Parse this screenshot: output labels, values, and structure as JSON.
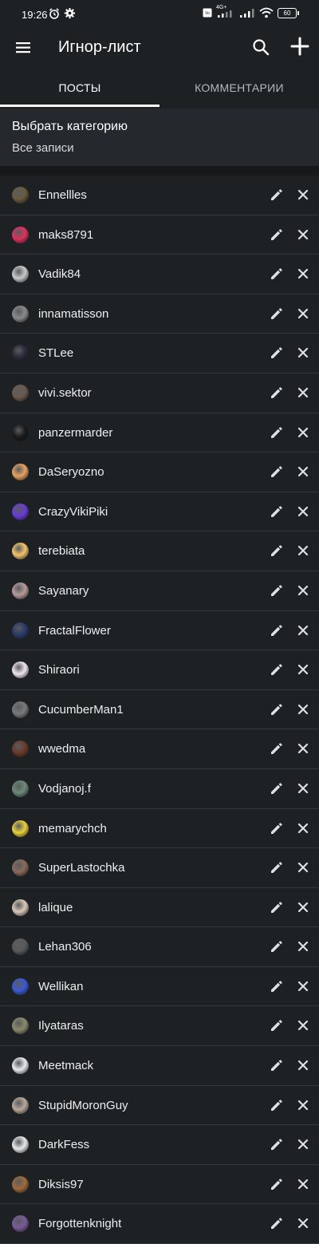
{
  "status_bar": {
    "time": "19:26",
    "network": "4G+",
    "battery": "60"
  },
  "toolbar": {
    "title": "Игнор-лист"
  },
  "tabs": [
    {
      "label": "ПОСТЫ",
      "active": true
    },
    {
      "label": "КОММЕНТАРИИ",
      "active": false
    }
  ],
  "category": {
    "label": "Выбрать категорию",
    "value": "Все записи"
  },
  "users": [
    {
      "name": "Ennellles",
      "avatar_color": "#6b5a3e"
    },
    {
      "name": "maks8791",
      "avatar_color": "#e0305a"
    },
    {
      "name": "Vadik84",
      "avatar_color": "#c8c8c8"
    },
    {
      "name": "innamatisson",
      "avatar_color": "#8a8a8a"
    },
    {
      "name": "STLee",
      "avatar_color": "#2a2a3a"
    },
    {
      "name": "vivi.sektor",
      "avatar_color": "#6e5a4e"
    },
    {
      "name": "panzermarder",
      "avatar_color": "#1a1a1a"
    },
    {
      "name": "DaSeryozno",
      "avatar_color": "#e8a060"
    },
    {
      "name": "CrazyVikiPiki",
      "avatar_color": "#6a3bd6"
    },
    {
      "name": "terebiata",
      "avatar_color": "#f2c46a"
    },
    {
      "name": "Sayanary",
      "avatar_color": "#b89a9a"
    },
    {
      "name": "FractalFlower",
      "avatar_color": "#2a3a6a"
    },
    {
      "name": "Shiraori",
      "avatar_color": "#f0e6ee"
    },
    {
      "name": "CucumberMan1",
      "avatar_color": "#7a7a7a"
    },
    {
      "name": "wwedma",
      "avatar_color": "#6a3a2a"
    },
    {
      "name": "Vodjanoj.f",
      "avatar_color": "#6a8a7a"
    },
    {
      "name": "memarychch",
      "avatar_color": "#e8d03a"
    },
    {
      "name": "SuperLastochka",
      "avatar_color": "#8a6a5a"
    },
    {
      "name": "lalique",
      "avatar_color": "#d8c8b8"
    },
    {
      "name": "Lehan306",
      "avatar_color": "#5a5a5a"
    },
    {
      "name": "Wellikan",
      "avatar_color": "#3a5ad6"
    },
    {
      "name": "Ilyataras",
      "avatar_color": "#8a8a6a"
    },
    {
      "name": "Meetmack",
      "avatar_color": "#e8e8f0"
    },
    {
      "name": "StupidMoronGuy",
      "avatar_color": "#b8a89a"
    },
    {
      "name": "DarkFess",
      "avatar_color": "#e8e8e8"
    },
    {
      "name": "Diksis97",
      "avatar_color": "#a06a3a"
    },
    {
      "name": "Forgottenknight",
      "avatar_color": "#7a5a9a"
    }
  ]
}
